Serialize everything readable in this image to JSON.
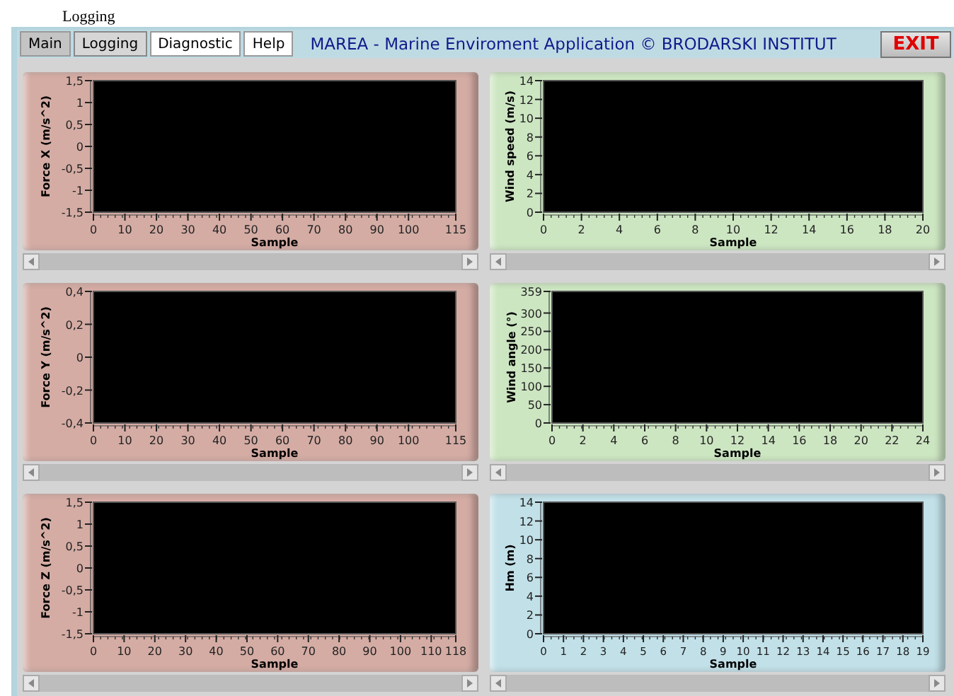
{
  "page_title": "Logging",
  "tabs": [
    {
      "label": "Main",
      "selected": false
    },
    {
      "label": "Logging",
      "selected": true
    },
    {
      "label": "Diagnostic",
      "selected": false
    },
    {
      "label": "Help",
      "selected": false
    }
  ],
  "app_title": "MAREA - Marine Enviroment Application © BRODARSKI INSTITUT",
  "exit_button": "EXIT",
  "graphs": [
    {
      "color": "#d4aca4",
      "chart_data": {
        "type": "line",
        "xlabel": "Sample",
        "ylabel": "Force X (m/s^2)",
        "xlim": [
          0,
          115
        ],
        "ylim": [
          -1.5,
          1.5
        ],
        "xticks": [
          0,
          10,
          20,
          30,
          40,
          50,
          60,
          70,
          80,
          90,
          100,
          115
        ],
        "yticks": [
          {
            "value": 1.5,
            "label": "1,5"
          },
          1,
          {
            "value": 0.5,
            "label": "0,5"
          },
          0,
          {
            "value": -0.5,
            "label": "-0,5"
          },
          -1,
          {
            "value": -1.5,
            "label": "-1,5"
          }
        ]
      }
    },
    {
      "color": "#cde6c2",
      "chart_data": {
        "type": "line",
        "xlabel": "Sample",
        "ylabel": "Wind speed (m/s)",
        "xlim": [
          0,
          20
        ],
        "ylim": [
          0,
          14
        ],
        "xticks": [
          0,
          2,
          4,
          6,
          8,
          10,
          12,
          14,
          16,
          18,
          20
        ],
        "yticks": [
          14,
          12,
          10,
          8,
          6,
          4,
          2,
          0
        ]
      }
    },
    {
      "color": "#d4aca4",
      "chart_data": {
        "type": "line",
        "xlabel": "Sample",
        "ylabel": "Force Y (m/s^2)",
        "xlim": [
          0,
          115
        ],
        "ylim": [
          -0.4,
          0.4
        ],
        "xticks": [
          0,
          10,
          20,
          30,
          40,
          50,
          60,
          70,
          80,
          90,
          100,
          115
        ],
        "yticks": [
          {
            "value": 0.4,
            "label": "0,4"
          },
          {
            "value": 0.2,
            "label": "0,2"
          },
          0,
          {
            "value": -0.2,
            "label": "-0,2"
          },
          {
            "value": -0.4,
            "label": "-0,4"
          }
        ]
      }
    },
    {
      "color": "#cde6c2",
      "chart_data": {
        "type": "line",
        "xlabel": "Sample",
        "ylabel": "Wind angle (°)",
        "xlim": [
          0,
          24
        ],
        "ylim": [
          0,
          359
        ],
        "xticks": [
          0,
          2,
          4,
          6,
          8,
          10,
          12,
          14,
          16,
          18,
          20,
          22,
          24
        ],
        "yticks": [
          359,
          300,
          250,
          200,
          150,
          100,
          50,
          0
        ]
      }
    },
    {
      "color": "#d4aca4",
      "chart_data": {
        "type": "line",
        "xlabel": "Sample",
        "ylabel": "Force Z (m/s^2)",
        "xlim": [
          0,
          118
        ],
        "ylim": [
          -1.5,
          1.5
        ],
        "xticks": [
          0,
          10,
          20,
          30,
          40,
          50,
          60,
          70,
          80,
          90,
          100,
          110,
          118
        ],
        "yticks": [
          {
            "value": 1.5,
            "label": "1,5"
          },
          1,
          {
            "value": 0.5,
            "label": "0,5"
          },
          0,
          {
            "value": -0.5,
            "label": "-0,5"
          },
          -1,
          {
            "value": -1.5,
            "label": "-1,5"
          }
        ]
      }
    },
    {
      "color": "#c2e0e8",
      "chart_data": {
        "type": "line",
        "xlabel": "Sample",
        "ylabel": "Hm (m)",
        "xlim": [
          0,
          19
        ],
        "ylim": [
          0,
          14
        ],
        "xticks": [
          0,
          1,
          2,
          3,
          4,
          5,
          6,
          7,
          8,
          9,
          10,
          11,
          12,
          13,
          14,
          15,
          16,
          17,
          18,
          19
        ],
        "yticks": [
          14,
          12,
          10,
          8,
          6,
          4,
          2,
          0
        ]
      }
    }
  ]
}
